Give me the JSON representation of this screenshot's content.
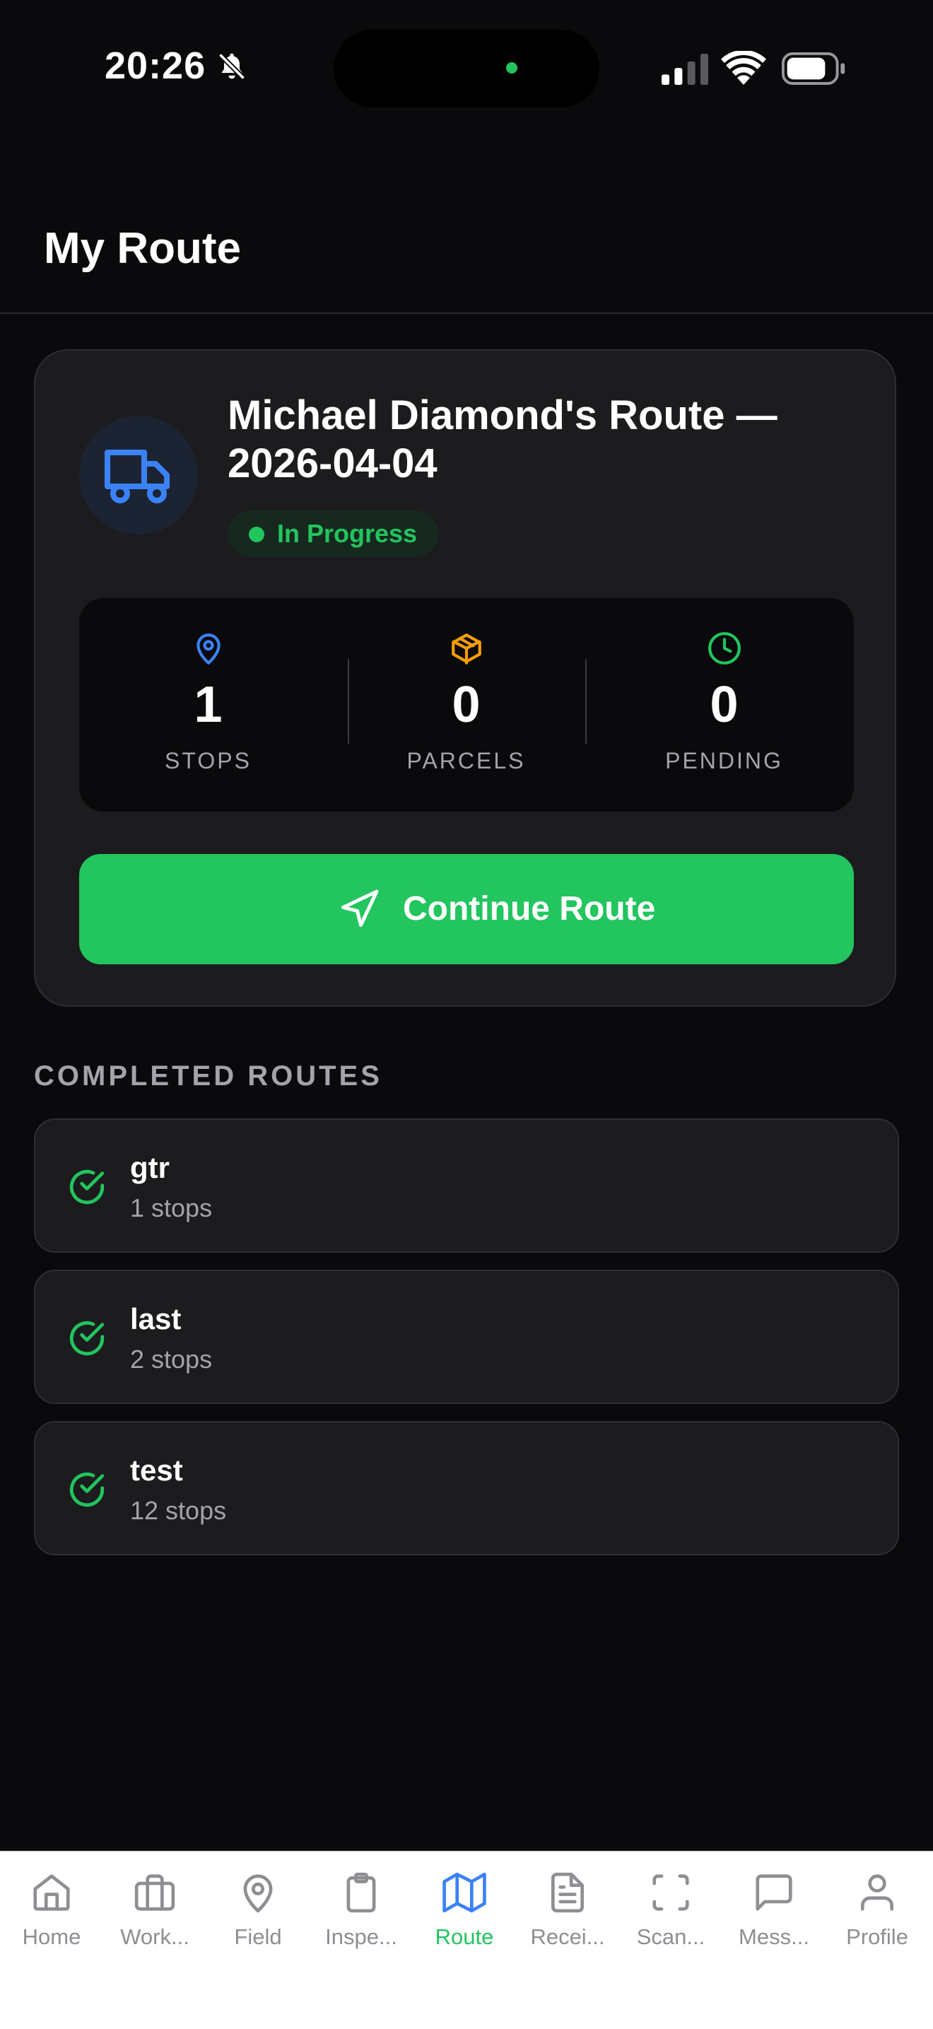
{
  "status_bar": {
    "time": "20:26"
  },
  "header": {
    "title": "My Route"
  },
  "route_card": {
    "title": "Michael Diamond's Route — 2026-04-04",
    "status": "In Progress",
    "stats": [
      {
        "value": "1",
        "label": "STOPS"
      },
      {
        "value": "0",
        "label": "PARCELS"
      },
      {
        "value": "0",
        "label": "PENDING"
      }
    ],
    "continue_label": "Continue Route"
  },
  "completed": {
    "title": "COMPLETED ROUTES",
    "items": [
      {
        "name": "gtr",
        "stops": "1 stops"
      },
      {
        "name": "last",
        "stops": "2 stops"
      },
      {
        "name": "test",
        "stops": "12 stops"
      }
    ]
  },
  "tabs": [
    {
      "label": "Home",
      "icon": "home-icon"
    },
    {
      "label": "Work...",
      "icon": "briefcase-icon"
    },
    {
      "label": "Field",
      "icon": "map-pin-icon"
    },
    {
      "label": "Inspe...",
      "icon": "clipboard-icon"
    },
    {
      "label": "Route",
      "icon": "map-icon"
    },
    {
      "label": "Recei...",
      "icon": "file-text-icon"
    },
    {
      "label": "Scan...",
      "icon": "scan-icon"
    },
    {
      "label": "Mess...",
      "icon": "message-icon"
    },
    {
      "label": "Profile",
      "icon": "user-icon"
    }
  ],
  "colors": {
    "accent_green": "#22c55e",
    "accent_blue": "#3b82f6",
    "accent_orange": "#f59e0b",
    "background": "#0a0a0c",
    "card": "#1c1c1f"
  }
}
